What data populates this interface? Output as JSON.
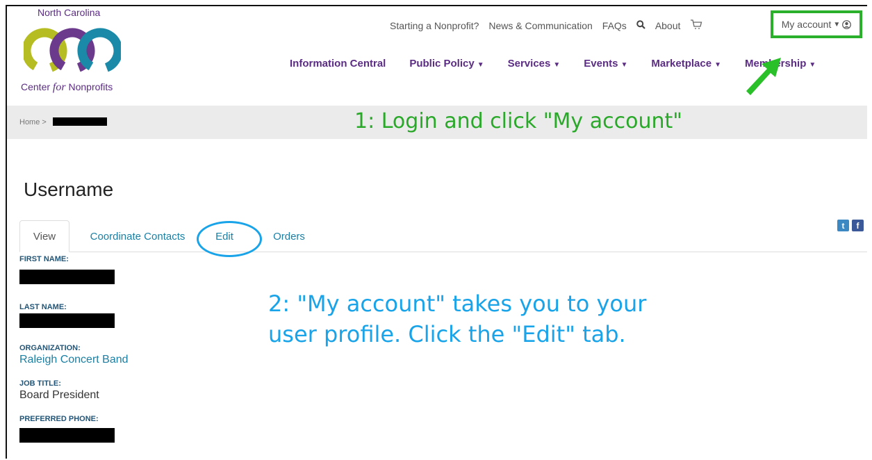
{
  "logo": {
    "top_text": "North Carolina",
    "bottom_prefix": "Center",
    "bottom_italic": "for",
    "bottom_suffix": "Nonprofits",
    "ring_colors": [
      "#b5bd22",
      "#6b3a8c",
      "#1a8aa8"
    ]
  },
  "utility_nav": {
    "items": [
      "Starting a Nonprofit?",
      "News & Communication",
      "FAQs"
    ],
    "search_icon": "search-icon",
    "about": "About",
    "cart_icon": "cart-icon",
    "my_account": "My account"
  },
  "main_nav": {
    "items": [
      {
        "label": "Information Central",
        "dropdown": false
      },
      {
        "label": "Public Policy",
        "dropdown": true
      },
      {
        "label": "Services",
        "dropdown": true
      },
      {
        "label": "Events",
        "dropdown": true
      },
      {
        "label": "Marketplace",
        "dropdown": true
      },
      {
        "label": "Membership",
        "dropdown": true
      }
    ]
  },
  "breadcrumb": {
    "home": "Home",
    "separator": ">"
  },
  "annotations": {
    "step1": "1: Login and click \"My account\"",
    "step2_line1": "2: \"My account\" takes you to your",
    "step2_line2": "user profile. Click the \"Edit\" tab.",
    "step1_color": "#2aa82a",
    "step2_color": "#19a3e8"
  },
  "social": {
    "twitter": "t",
    "facebook": "f"
  },
  "page_title": "Username",
  "tabs": [
    {
      "label": "View",
      "active": true
    },
    {
      "label": "Coordinate Contacts",
      "active": false
    },
    {
      "label": "Edit",
      "active": false
    },
    {
      "label": "Orders",
      "active": false
    }
  ],
  "profile": {
    "first_name_label": "First name:",
    "last_name_label": "Last name:",
    "organization_label": "Organization:",
    "organization_value": "Raleigh Concert Band",
    "job_title_label": "Job title:",
    "job_title_value": "Board President",
    "preferred_phone_label": "Preferred phone:"
  },
  "colors": {
    "brand_purple": "#5b2c83",
    "link_teal": "#1a7fa3",
    "highlight_green": "#2ab02a"
  }
}
